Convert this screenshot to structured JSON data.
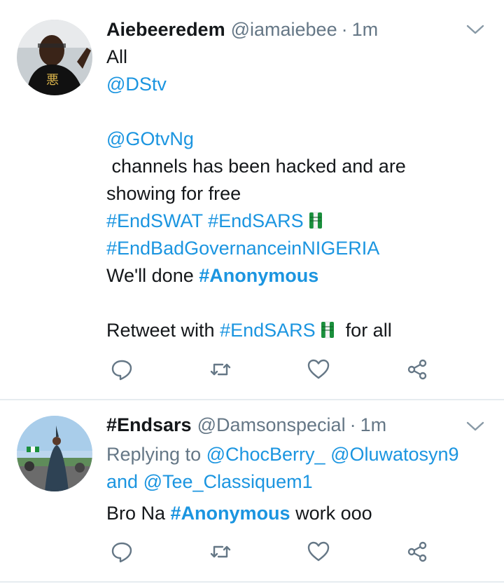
{
  "tweets": [
    {
      "name": "Aiebeeredem",
      "handle": "@iamaiebee",
      "separator": "·",
      "time": "1m",
      "body": {
        "line1": "All",
        "mention1": "@DStv",
        "mention2": "@GOtvNg",
        "text1": " channels has been hacked and are",
        "text2": "showing for free",
        "tag1": "#EndSWAT",
        "tag2": "#EndSARS",
        "tag3": "#EndBadGovernanceinNIGERIA",
        "text3": "We'll done ",
        "tag4": "#Anonymous",
        "text4": "Retweet with ",
        "tag5": "#EndSARS",
        "text5": "  for all"
      }
    },
    {
      "name": "#Endsars",
      "handle": "@Damsonspecial",
      "separator": "·",
      "time": "1m",
      "replying_prefix": "Replying to ",
      "reply_to1": "@ChocBerry_",
      "reply_to2": "@Oluwatosyn9",
      "reply_and": "and ",
      "reply_to3": "@Tee_Classiquem1",
      "body": {
        "text1": "Bro Na ",
        "tag1": "#Anonymous",
        "text2": " work ooo"
      }
    }
  ],
  "icons": {
    "reply": "reply-icon",
    "retweet": "retweet-icon",
    "like": "heart-icon",
    "share": "share-icon",
    "caret": "chevron-down-icon",
    "flag_fist": "raised-fist-nigeria-flag-icon"
  },
  "colors": {
    "link": "#1b95e0",
    "muted": "#657786",
    "text": "#14171a",
    "divider": "#e6ecf0"
  }
}
